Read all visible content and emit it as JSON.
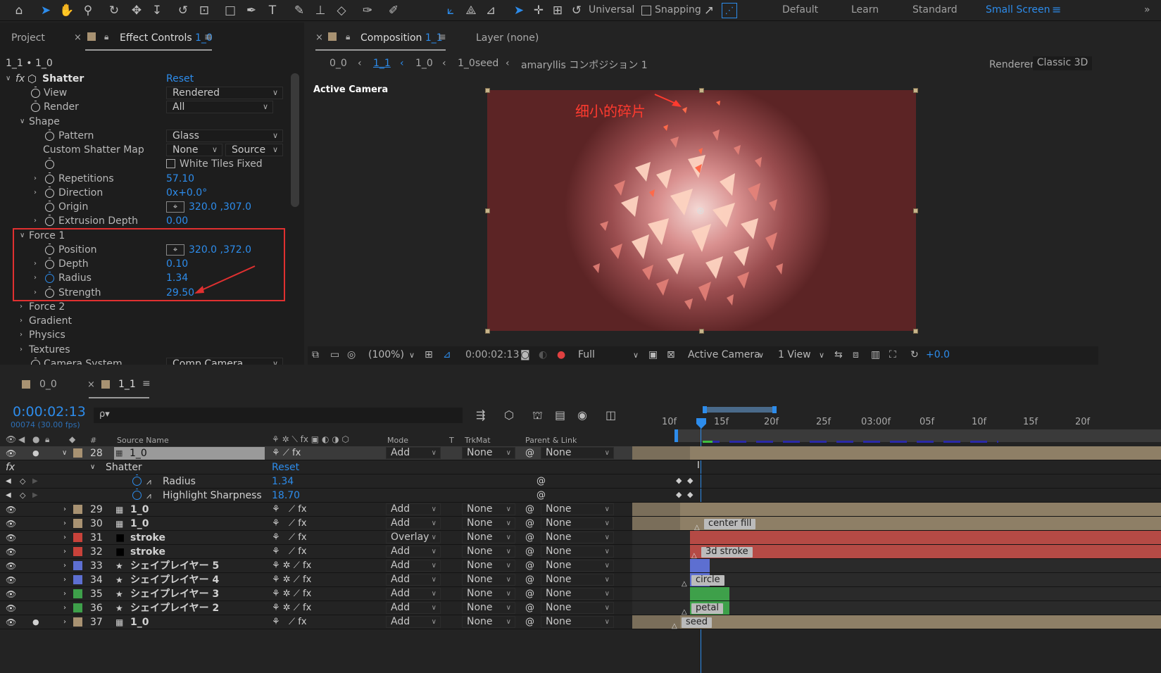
{
  "colors": {
    "accent": "#2d8ceb",
    "redbox": "#e03030",
    "labelTan": "#a89272",
    "labelRed": "#c8423a",
    "labelBlue": "#5d6fd1",
    "labelGreen": "#3ea04a"
  },
  "toolbar": {
    "icons": [
      "home-icon",
      "selection-tool-icon",
      "hand-tool-icon",
      "zoom-tool-icon",
      "orbit-camera-icon",
      "pan-camera-icon",
      "dolly-camera-icon",
      "rotate-tool-icon",
      "pan-behind-icon",
      "rectangle-tool-icon",
      "pen-tool-icon",
      "type-tool-icon",
      "brush-tool-icon",
      "clone-stamp-icon",
      "eraser-icon",
      "roto-brush-icon",
      "puppet-pin-icon",
      "local-axis-icon",
      "world-axis-icon",
      "view-axis-icon",
      "select-3d-icon",
      "move-3d-icon",
      "scale-3d-icon",
      "rotate-3d-icon"
    ],
    "universal_label": "Universal",
    "snapping_label": "Snapping",
    "workspaces": [
      "Default",
      "Learn",
      "Standard",
      "Small Screen"
    ],
    "active_workspace": "Small Screen",
    "menu_icon": "≡"
  },
  "effect_controls": {
    "tab_project": "Project",
    "tab_label": "Effect Controls",
    "tab_layer": "1_0",
    "breadcrumb": "1_1 • 1_0",
    "fx_label": "fx",
    "effect_name": "Shatter",
    "reset": "Reset",
    "rows": {
      "view": {
        "label": "View",
        "value": "Rendered"
      },
      "render": {
        "label": "Render",
        "value": "All"
      },
      "shape": {
        "label": "Shape"
      },
      "pattern": {
        "label": "Pattern",
        "value": "Glass"
      },
      "custom_map": {
        "label": "Custom Shatter Map",
        "value1": "None",
        "value2": "Source"
      },
      "white_tiles": {
        "label": "White Tiles Fixed"
      },
      "repetitions": {
        "label": "Repetitions",
        "value": "57.10"
      },
      "direction": {
        "label": "Direction",
        "value": "0x+0.0°"
      },
      "origin": {
        "label": "Origin",
        "value": "320.0 ,307.0"
      },
      "extrusion": {
        "label": "Extrusion Depth",
        "value": "0.00"
      },
      "force1": {
        "label": "Force 1"
      },
      "position": {
        "label": "Position",
        "value": "320.0 ,372.0"
      },
      "depth": {
        "label": "Depth",
        "value": "0.10"
      },
      "radius": {
        "label": "Radius",
        "value": "1.34"
      },
      "strength": {
        "label": "Strength",
        "value": "29.50"
      },
      "force2": {
        "label": "Force 2"
      },
      "gradient": {
        "label": "Gradient"
      },
      "physics": {
        "label": "Physics"
      },
      "textures": {
        "label": "Textures"
      },
      "camera_system": {
        "label": "Camera System",
        "value": "Comp Camera"
      }
    }
  },
  "composition": {
    "tab_label": "Composition",
    "tab_comp": "1_1",
    "layer_label": "Layer",
    "layer_value": "(none)",
    "flow": [
      "0_0",
      "1_1",
      "1_0",
      "1_0seed",
      "amaryllis コンポジション 1"
    ],
    "renderer_label": "Renderer:",
    "renderer_value": "Classic 3D",
    "active_camera": "Active Camera",
    "annotation": "细小的碎片"
  },
  "viewer_bar": {
    "zoom": "(100%)",
    "timecode": "0:00:02:13",
    "resolution": "Full",
    "camera": "Active Camera",
    "views": "1 View",
    "exposure": "+0.0"
  },
  "timeline": {
    "tabs": [
      {
        "label": "0_0"
      },
      {
        "label": "1_1"
      }
    ],
    "timecode": "0:00:02:13",
    "frames": "00074 (30.00 fps)",
    "search_placeholder": "ρ▾",
    "col_hash": "#",
    "col_source": "Source Name",
    "col_mode": "Mode",
    "col_t": "T",
    "col_trkmat": "TrkMat",
    "col_parent": "Parent & Link",
    "ruler": [
      "10f",
      "15f",
      "20f",
      "25f",
      "03:00f",
      "05f",
      "10f",
      "15f",
      "20f"
    ],
    "layer28": {
      "num": "28",
      "name": "1_0",
      "mode": "Add",
      "trkmat": "None",
      "parent": "None"
    },
    "shatter": {
      "name": "Shatter",
      "reset": "Reset"
    },
    "radius": {
      "name": "Radius",
      "value": "1.34"
    },
    "highlight": {
      "name": "Highlight Sharpness",
      "value": "18.70"
    },
    "layers": [
      {
        "num": "29",
        "name": "1_0",
        "mode": "Add",
        "trkmat": "None",
        "parent": "None"
      },
      {
        "num": "30",
        "name": "1_0",
        "mode": "Add",
        "trkmat": "None",
        "parent": "None"
      },
      {
        "num": "31",
        "name": "stroke",
        "mode": "Overlay",
        "trkmat": "None",
        "parent": "None"
      },
      {
        "num": "32",
        "name": "stroke",
        "mode": "Add",
        "trkmat": "None",
        "parent": "None"
      },
      {
        "num": "33",
        "name": "シェイプレイヤー 5",
        "mode": "Add",
        "trkmat": "None",
        "parent": "None"
      },
      {
        "num": "34",
        "name": "シェイプレイヤー 4",
        "mode": "Add",
        "trkmat": "None",
        "parent": "None"
      },
      {
        "num": "35",
        "name": "シェイプレイヤー 3",
        "mode": "Add",
        "trkmat": "None",
        "parent": "None"
      },
      {
        "num": "36",
        "name": "シェイプレイヤー 2",
        "mode": "Add",
        "trkmat": "None",
        "parent": "None"
      },
      {
        "num": "37",
        "name": "1_0",
        "mode": "Add",
        "trkmat": "None",
        "parent": "None"
      }
    ],
    "bar_labels": {
      "center_fill": "center fill",
      "stroke3d": "3d stroke",
      "circle": "circle",
      "petal": "petal",
      "seed": "seed"
    }
  }
}
